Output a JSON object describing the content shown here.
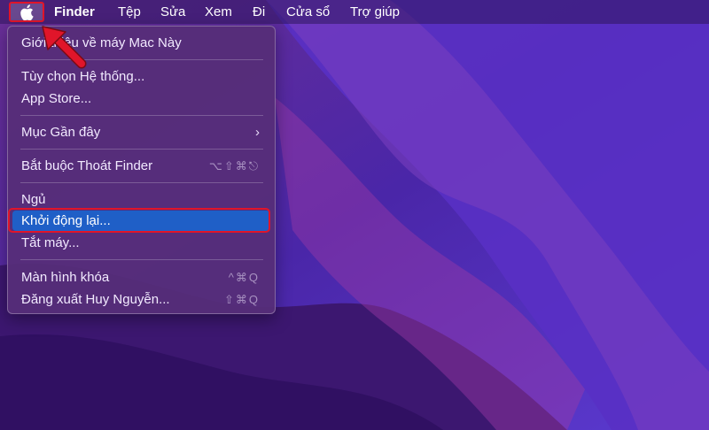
{
  "menubar": {
    "app_name": "Finder",
    "menus": [
      "Tệp",
      "Sửa",
      "Xem",
      "Đi",
      "Cửa sổ",
      "Trợ giúp"
    ]
  },
  "apple_menu": {
    "items": {
      "about": "Giới thiệu về máy Mac Này",
      "system_prefs": "Tùy chọn Hệ thống...",
      "app_store": "App Store...",
      "recent_items": "Mục Gần đây",
      "force_quit": "Bắt buộc Thoát Finder",
      "force_quit_shortcut": "⌥⇧⌘⎋",
      "sleep": "Ngủ",
      "restart": "Khởi động lại...",
      "shutdown": "Tắt máy...",
      "lock_screen": "Màn hình khóa",
      "lock_screen_shortcut": "^⌘Q",
      "logout": "Đăng xuất Huy Nguyễn...",
      "logout_shortcut": "⇧⌘Q"
    },
    "selected": "Khởi động lại..."
  },
  "colors": {
    "annotation_red": "#e0152a",
    "selection_blue": "#1f5fc7"
  },
  "icons": {
    "apple": "apple-icon",
    "submenu": "chevron-right-icon",
    "annotation": "red-arrow-icon"
  }
}
